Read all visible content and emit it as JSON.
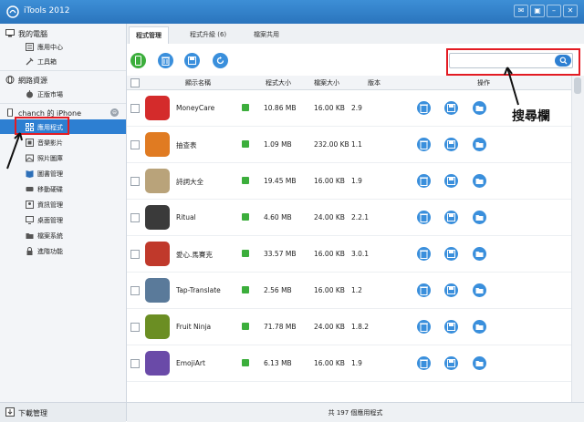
{
  "app": {
    "title": "iTools 2012"
  },
  "sidebar": {
    "sections": [
      {
        "label": "我的電腦",
        "icon": "computer-icon"
      },
      {
        "label": "網路資源",
        "icon": "globe-icon"
      },
      {
        "label": "chanch 的 iPhone",
        "icon": "phone-icon",
        "badge": "⊖"
      }
    ],
    "items": [
      {
        "label": "應用中心",
        "icon": "app-center-icon"
      },
      {
        "label": "工具箱",
        "icon": "toolbox-icon"
      },
      {
        "label": "正版市場",
        "icon": "apple-icon"
      },
      {
        "label": "應用程式",
        "icon": "grid-icon"
      },
      {
        "label": "音樂影片",
        "icon": "film-icon"
      },
      {
        "label": "照片圖庫",
        "icon": "photo-icon"
      },
      {
        "label": "圖書管理",
        "icon": "book-icon"
      },
      {
        "label": "移動硬碟",
        "icon": "drive-icon"
      },
      {
        "label": "資訊管理",
        "icon": "contacts-icon"
      },
      {
        "label": "桌面管理",
        "icon": "desktop-icon"
      },
      {
        "label": "檔案系統",
        "icon": "folder-icon"
      },
      {
        "label": "進階功能",
        "icon": "lock-icon"
      }
    ],
    "bottom": {
      "label": "下載管理",
      "icon": "download-icon"
    }
  },
  "tabs": [
    {
      "label": "程式管理"
    },
    {
      "label": "程式升級 (6)"
    },
    {
      "label": "檔案共用"
    }
  ],
  "table": {
    "headers": [
      "顯示名稱",
      "程式大小",
      "檔案大小",
      "版本",
      "操作"
    ],
    "rows": [
      {
        "name": "MoneyCare",
        "size": "10.86 MB",
        "docsize": "16.00 KB",
        "version": "2.9",
        "icon_color": "#d42b2b"
      },
      {
        "name": "抽查表",
        "size": "1.09 MB",
        "docsize": "232.00 KB",
        "version": "1.1",
        "icon_color": "#e07b22"
      },
      {
        "name": "詩詞大全",
        "size": "19.45 MB",
        "docsize": "16.00 KB",
        "version": "1.9",
        "icon_color": "#b9a37a"
      },
      {
        "name": "Ritual",
        "size": "4.60 MB",
        "docsize": "24.00 KB",
        "version": "2.2.1",
        "icon_color": "#3a3a3a"
      },
      {
        "name": "愛心.馬賽克",
        "size": "33.57 MB",
        "docsize": "16.00 KB",
        "version": "3.0.1",
        "icon_color": "#c0392b"
      },
      {
        "name": "Tap-Translate",
        "size": "2.56 MB",
        "docsize": "16.00 KB",
        "version": "1.2",
        "icon_color": "#5a7a9a"
      },
      {
        "name": "Fruit Ninja",
        "size": "71.78 MB",
        "docsize": "24.00 KB",
        "version": "1.8.2",
        "icon_color": "#6b8e23"
      },
      {
        "name": "EmojiArt",
        "size": "6.13 MB",
        "docsize": "16.00 KB",
        "version": "1.9",
        "icon_color": "#6a4aa8"
      }
    ]
  },
  "status": {
    "text": "共 197 個應用程式"
  },
  "annotation": {
    "label": "搜尋欄"
  },
  "colors": {
    "accent": "#2d7fd2",
    "annotation": "#e31b23",
    "titlebar": "#2a74bd"
  }
}
